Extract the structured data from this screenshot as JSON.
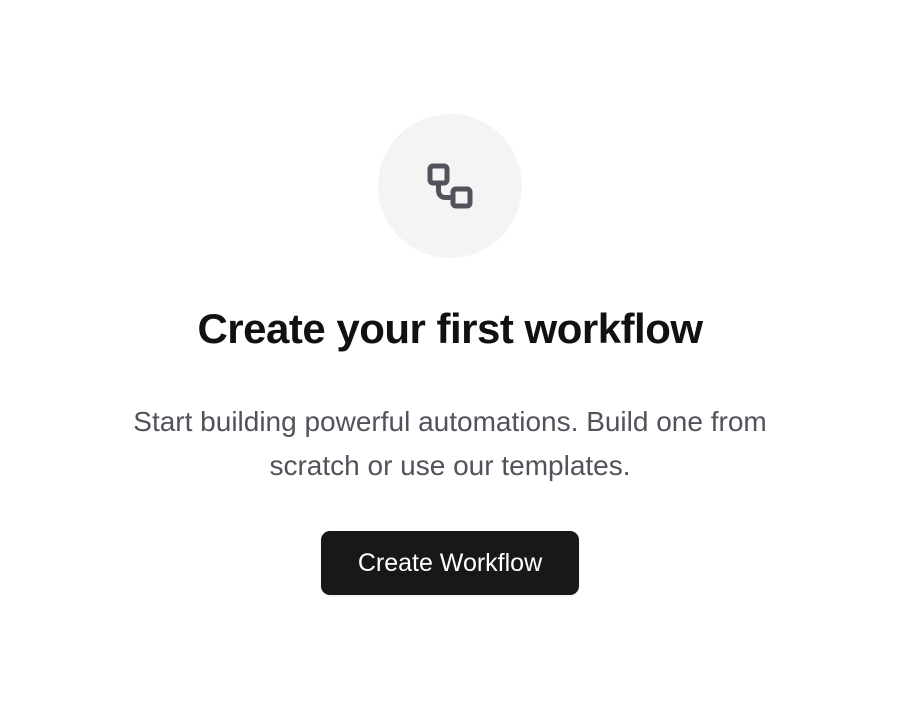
{
  "empty_state": {
    "icon": "workflow-icon",
    "title": "Create your first workflow",
    "description": "Start building powerful automations. Build one from scratch or use our templates.",
    "button_label": "Create Workflow"
  },
  "colors": {
    "icon_background": "#f4f4f5",
    "icon_stroke": "#52525b",
    "title": "#111113",
    "description": "#52525b",
    "button_background": "#18181b",
    "button_text": "#ffffff"
  }
}
